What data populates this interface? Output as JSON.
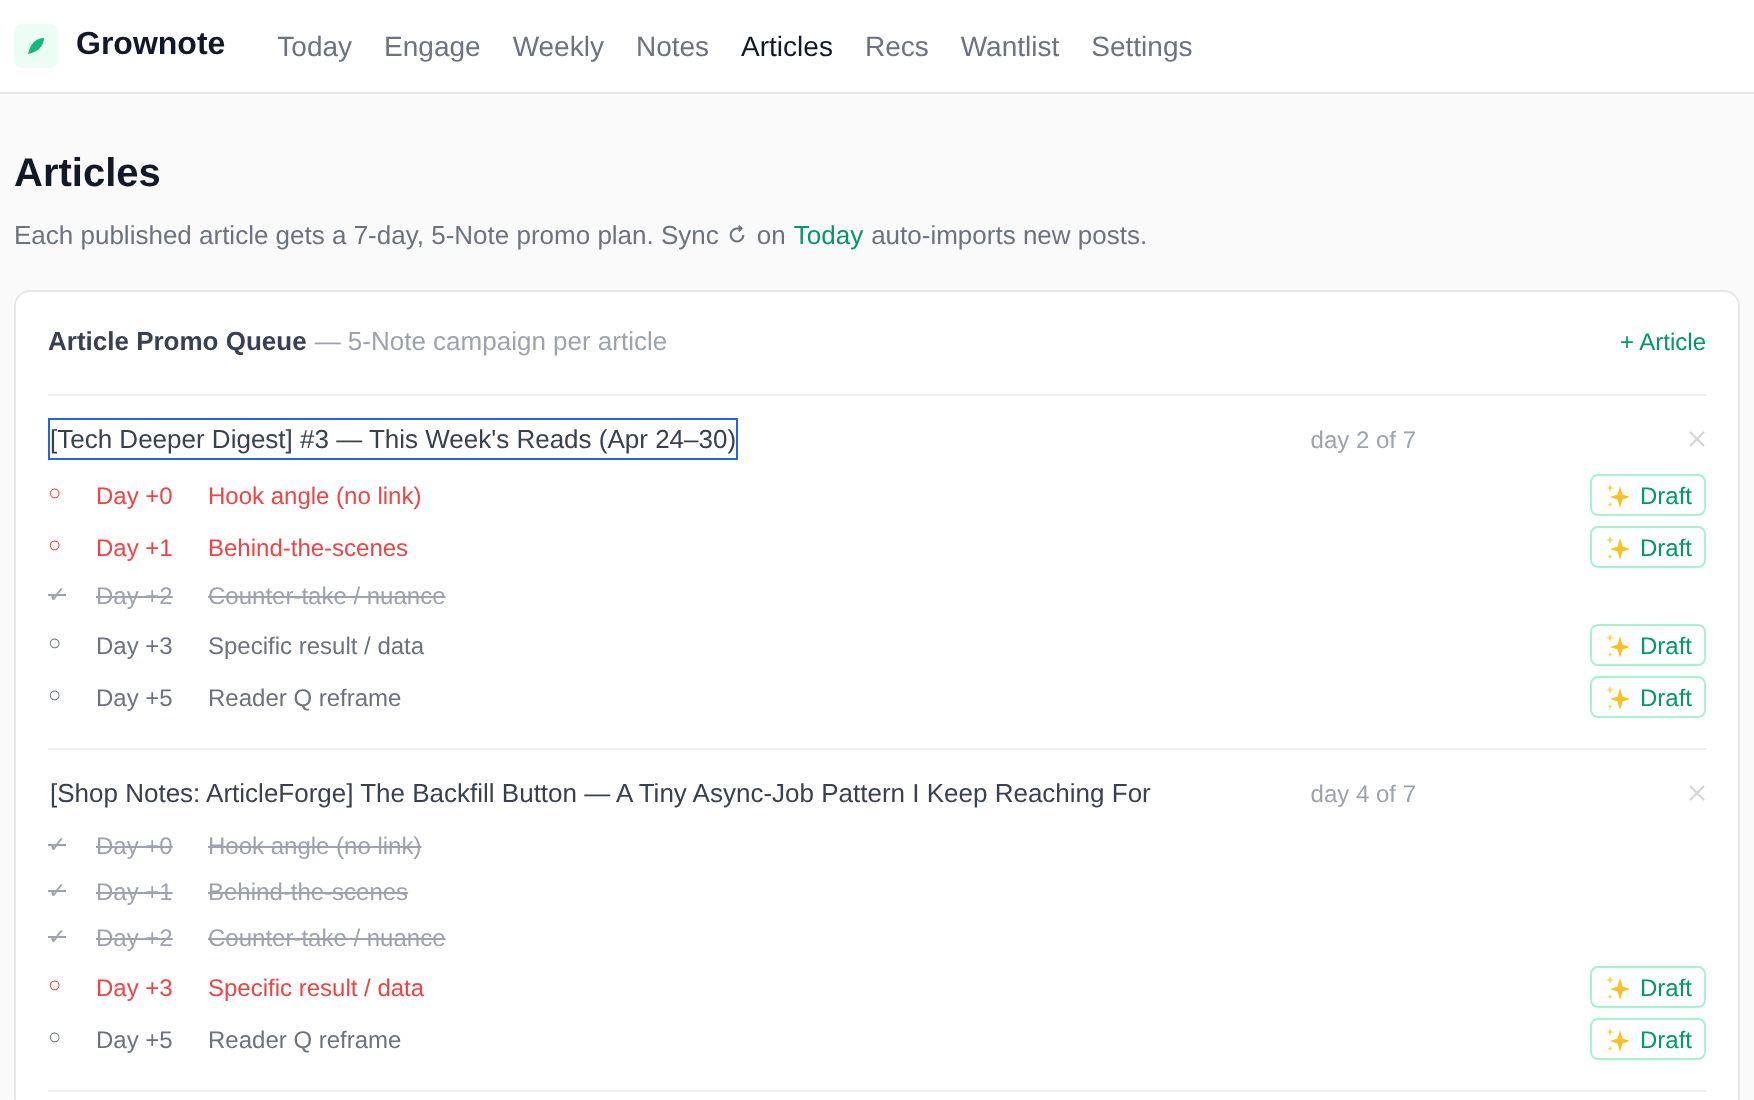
{
  "brand": {
    "name": "Grownote"
  },
  "nav": [
    {
      "label": "Today",
      "selected": false
    },
    {
      "label": "Engage",
      "selected": false
    },
    {
      "label": "Weekly",
      "selected": false
    },
    {
      "label": "Notes",
      "selected": false
    },
    {
      "label": "Articles",
      "selected": true
    },
    {
      "label": "Recs",
      "selected": false
    },
    {
      "label": "Wantlist",
      "selected": false
    },
    {
      "label": "Settings",
      "selected": false
    }
  ],
  "page": {
    "title": "Articles",
    "intro_before": "Each published article gets a 7-day, 5-Note promo plan. Sync",
    "intro_mid": "on",
    "intro_link": "Today",
    "intro_after": "auto-imports new posts."
  },
  "queue": {
    "title": "Article Promo Queue",
    "subtitle": "— 5-Note campaign per article",
    "add_button": "+ Article",
    "articles": [
      {
        "title": "[Tech Deeper Digest] #3 — This Week's Reads (Apr 24–30)",
        "focused": true,
        "progress": "day 2 of 7",
        "steps": [
          {
            "kind": "due",
            "mark": "○",
            "day": "Day +0",
            "label": "Hook angle (no link)",
            "action": "Draft"
          },
          {
            "kind": "due",
            "mark": "○",
            "day": "Day +1",
            "label": "Behind-the-scenes",
            "action": "Draft"
          },
          {
            "kind": "done",
            "mark": "✓",
            "day": "Day +2",
            "label": "Counter-take / nuance"
          },
          {
            "kind": "upcoming",
            "mark": "○",
            "day": "Day +3",
            "label": "Specific result / data",
            "action": "Draft"
          },
          {
            "kind": "upcoming",
            "mark": "○",
            "day": "Day +5",
            "label": "Reader Q reframe",
            "action": "Draft"
          }
        ]
      },
      {
        "title": "[Shop Notes: ArticleForge] The Backfill Button — A Tiny Async-Job Pattern I Keep Reaching For",
        "focused": false,
        "progress": "day 4 of 7",
        "steps": [
          {
            "kind": "done",
            "mark": "✓",
            "day": "Day +0",
            "label": "Hook angle (no link)"
          },
          {
            "kind": "done",
            "mark": "✓",
            "day": "Day +1",
            "label": "Behind-the-scenes"
          },
          {
            "kind": "done",
            "mark": "✓",
            "day": "Day +2",
            "label": "Counter-take / nuance"
          },
          {
            "kind": "due",
            "mark": "○",
            "day": "Day +3",
            "label": "Specific result / data",
            "action": "Draft"
          },
          {
            "kind": "upcoming",
            "mark": "○",
            "day": "Day +5",
            "label": "Reader Q reframe",
            "action": "Draft"
          }
        ]
      }
    ]
  }
}
